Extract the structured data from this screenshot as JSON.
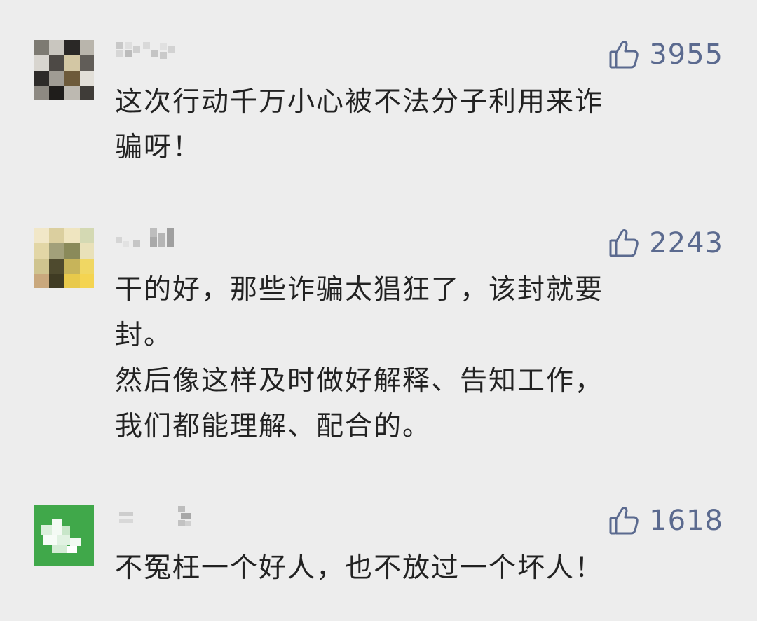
{
  "accent_color": "#5b6a8f",
  "comments": [
    {
      "likes": "3955",
      "text": "这次行动千万小心被不法分子利用来诈\n骗呀！"
    },
    {
      "likes": "2243",
      "text": "干的好，那些诈骗太猖狂了，该封就要\n封。\n然后像这样及时做好解释、告知工作，\n我们都能理解、配合的。"
    },
    {
      "likes": "1618",
      "text": "不冤枉一个好人，也不放过一个坏人！"
    }
  ]
}
